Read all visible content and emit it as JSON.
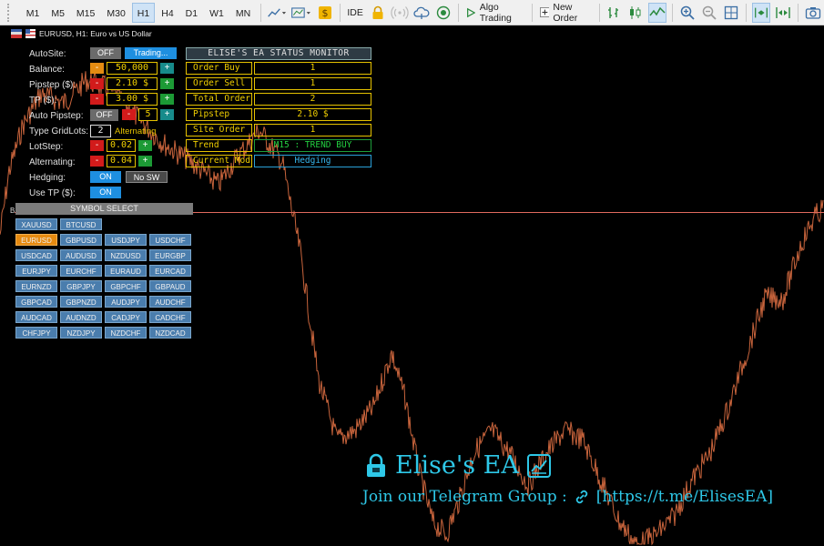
{
  "toolbar": {
    "timeframes": [
      {
        "label": "M1",
        "active": false
      },
      {
        "label": "M5",
        "active": false
      },
      {
        "label": "M15",
        "active": false
      },
      {
        "label": "M30",
        "active": false
      },
      {
        "label": "H1",
        "active": true
      },
      {
        "label": "H4",
        "active": false
      },
      {
        "label": "D1",
        "active": false
      },
      {
        "label": "W1",
        "active": false
      },
      {
        "label": "MN",
        "active": false
      }
    ],
    "ide_label": "IDE",
    "algo_trading_label": "Algo Trading",
    "new_order_label": "New Order"
  },
  "chart": {
    "title": "EURUSD, H1:  Euro vs US Dollar",
    "line_label": "B"
  },
  "panel": {
    "autosite": {
      "label": "AutoSite:",
      "off": "OFF",
      "trading": "Trading..."
    },
    "balance": {
      "label": "Balance:",
      "minus": "-",
      "value": "50,000",
      "plus": "+"
    },
    "pipstep": {
      "label": "Pipstep ($):",
      "minus": "-",
      "value": "2.10 $",
      "plus": "+"
    },
    "tp": {
      "label": "TP ($):",
      "minus": "-",
      "value": "3.00 $",
      "plus": "+"
    },
    "auto_pipstep": {
      "label": "Auto Pipstep:",
      "off": "OFF",
      "minus": "-",
      "value": "5",
      "plus": "+"
    },
    "type_gridlots": {
      "label": "Type GridLots:",
      "value": "2",
      "mode": "Alternating"
    },
    "lotstep": {
      "label": "LotStep:",
      "minus": "-",
      "value": "0.02",
      "plus": "+"
    },
    "alternating": {
      "label": "Alternating:",
      "minus": "-",
      "value": "0.04",
      "plus": "+"
    },
    "hedging": {
      "label": "Hedging:",
      "on": "ON",
      "nosw": "No SW"
    },
    "use_tp": {
      "label": "Use TP ($):",
      "on": "ON"
    }
  },
  "monitor": {
    "title": "ELISE'S EA STATUS MONITOR",
    "rows": [
      {
        "label": "Order Buy",
        "value": "1"
      },
      {
        "label": "Order Sell",
        "value": "1"
      },
      {
        "label": "Total Order",
        "value": "2"
      },
      {
        "label": "Pipstep",
        "value": "2.10 $"
      },
      {
        "label": "Site Order",
        "value": "1"
      },
      {
        "label": "Trend",
        "value": "M15 : TREND BUY"
      },
      {
        "label": "Current Mod",
        "value": "Hedging"
      }
    ]
  },
  "symbols": {
    "header": "SYMBOL SELECT",
    "selected": "EURUSD",
    "rows": [
      [
        "XAUUSD",
        "BTCUSD"
      ],
      [
        "EURUSD",
        "GBPUSD",
        "USDJPY",
        "USDCHF"
      ],
      [
        "USDCAD",
        "AUDUSD",
        "NZDUSD",
        "EURGBP"
      ],
      [
        "EURJPY",
        "EURCHF",
        "EURAUD",
        "EURCAD"
      ],
      [
        "EURNZD",
        "GBPJPY",
        "GBPCHF",
        "GBPAUD"
      ],
      [
        "GBPCAD",
        "GBPNZD",
        "AUDJPY",
        "AUDCHF"
      ],
      [
        "AUDCAD",
        "AUDNZD",
        "CADJPY",
        "CADCHF"
      ],
      [
        "CHFJPY",
        "NZDJPY",
        "NZDCHF",
        "NZDCAD"
      ]
    ]
  },
  "watermark": {
    "title": "Elise's EA",
    "subtitle": "Join our Telegram Group :",
    "link": "[https://t.me/ElisesEA]"
  },
  "colors": {
    "price_line": "#c8643c",
    "level_line": "#e06a5e",
    "accent_cyan": "#2ec8e8",
    "value_yellow": "#f2d000"
  }
}
